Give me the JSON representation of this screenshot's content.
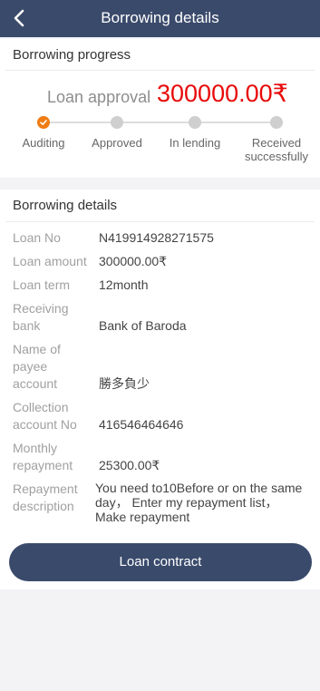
{
  "header": {
    "title": "Borrowing details",
    "back_icon": "chevron-left-icon"
  },
  "progress": {
    "title": "Borrowing progress",
    "approval_label": "Loan approval",
    "approval_amount": "300000.00₹",
    "steps": [
      {
        "label": "Auditing",
        "state": "done"
      },
      {
        "label": "Approved",
        "state": "pending"
      },
      {
        "label": "In lending",
        "state": "pending"
      },
      {
        "label": "Received successfully",
        "state": "pending"
      }
    ]
  },
  "details": {
    "title": "Borrowing details",
    "rows": [
      {
        "label": "Loan No",
        "value": "N419914928271575"
      },
      {
        "label": "Loan amount",
        "value": "300000.00₹"
      },
      {
        "label": "Loan term",
        "value": "12month"
      },
      {
        "label": "Receiving bank",
        "value": "Bank of Baroda"
      },
      {
        "label": "Name of payee account",
        "value": "勝多負少"
      },
      {
        "label": "Collection account No",
        "value": "416546464646"
      },
      {
        "label": "Monthly repayment",
        "value": "25300.00₹"
      },
      {
        "label": "Repayment description",
        "value": "You need to10Before or on the same day， Enter my repayment list，Make repayment"
      }
    ]
  },
  "footer": {
    "contract_button": "Loan contract"
  },
  "colors": {
    "header": "#3a4a6b",
    "accent": "#f07c14",
    "amount": "#e80a0a"
  }
}
